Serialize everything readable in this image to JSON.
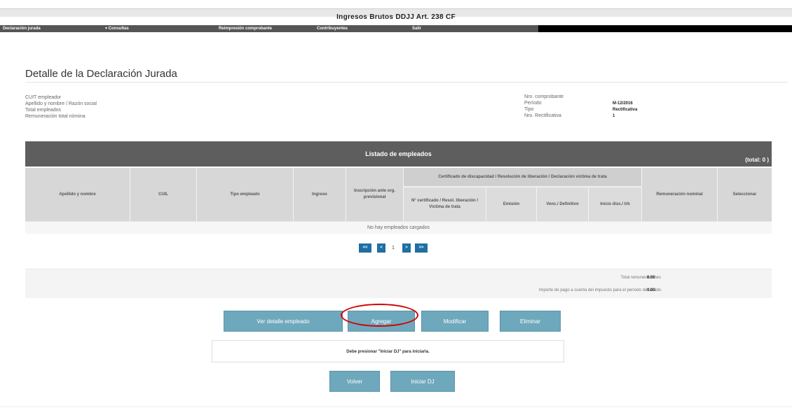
{
  "app": {
    "title": "Ingresos Brutos DDJJ Art. 238 CF"
  },
  "menu": [
    {
      "label": "Declaración jurada"
    },
    {
      "label": "▾ Consultas"
    },
    {
      "label": "Reimpresión comprobante"
    },
    {
      "label": "Contribuyentes"
    },
    {
      "label": "Salir"
    }
  ],
  "page": {
    "title": "Detalle de la Declaración Jurada"
  },
  "info_left": [
    {
      "label": "CUIT empleador"
    },
    {
      "label": "Apellido y nombre / Razón social"
    },
    {
      "label": "Total empleados"
    },
    {
      "label": "Remuneración total nómina"
    }
  ],
  "info_right": [
    {
      "label": "Nro. comprobante",
      "value": ""
    },
    {
      "label": "Período",
      "value": "M-12/2016"
    },
    {
      "label": "Tipo",
      "value": "Rectificativa"
    },
    {
      "label": "Nro. Rectificativa",
      "value": "1"
    }
  ],
  "grid": {
    "title": "Listado de empleados",
    "total": "(total: 0 )",
    "columns": [
      "Apellido y nombre",
      "CUIL",
      "Tipo empleado",
      "Ingreso",
      "Inscripción ante org. previsional",
      "Remuneración nominal",
      "Seleccionar"
    ],
    "group_header": "Certificado de discapacidad / Resolución de liberación / Declaración víctima de trata",
    "sub_columns": [
      "N° certificado / Resol. liberación / Víctima de trata",
      "Emisión",
      "Venc./ Definitivo",
      "Inicio disc./ trb"
    ],
    "empty_message": "No hay empleados cargados"
  },
  "pager": {
    "first": "<<",
    "prev": "<",
    "page": "1",
    "next": ">",
    "last": ">>"
  },
  "totals": [
    {
      "label": "Total remuneraciones",
      "value": "0.00"
    },
    {
      "label": "Importe de pago a cuenta del impuesto para el período declarado",
      "value": "0.00"
    }
  ],
  "actions": {
    "ver_detalle": "Ver detalle empleado",
    "agregar": "Agregar",
    "modificar": "Modificar",
    "eliminar": "Eliminar",
    "volver": "Volver",
    "iniciar": "Iniciar DJ"
  },
  "message": "Debe presionar \"Iniciar DJ\" para iniciarla."
}
